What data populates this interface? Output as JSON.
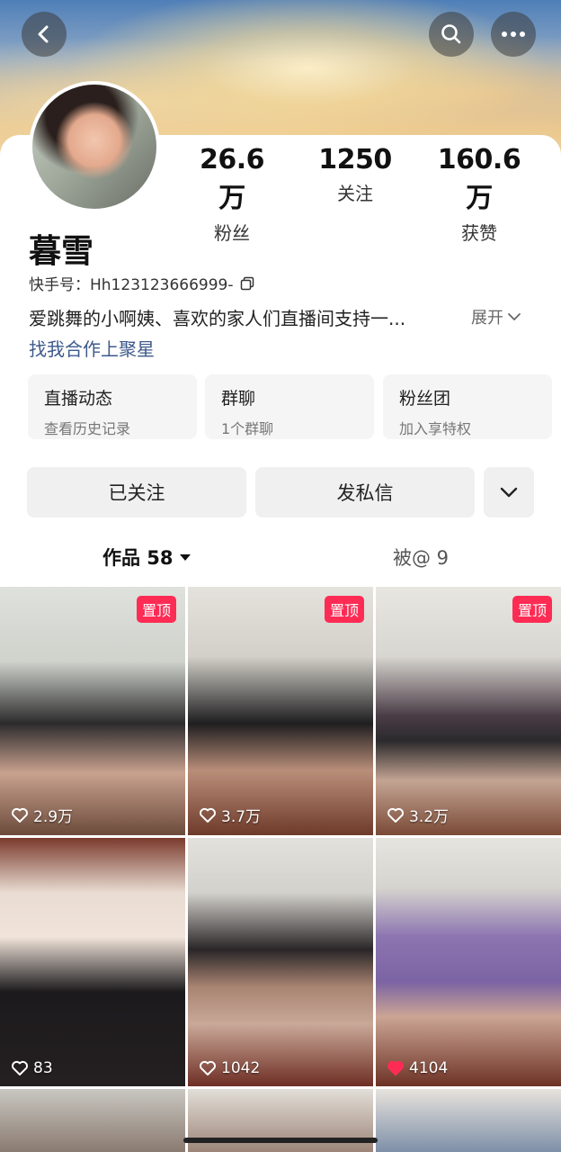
{
  "profile": {
    "stats": [
      {
        "num": "26.6万",
        "label": "粉丝"
      },
      {
        "num": "1250",
        "label": "关注"
      },
      {
        "num": "160.6万",
        "label": "获赞"
      }
    ],
    "name": "暮雪",
    "uid": "快手号：Hh123123666999-",
    "bio": "爱跳舞的小啊姨、喜欢的家人们直播间支持一...",
    "expand": "展开",
    "collab": "找我合作上聚星"
  },
  "quick_cards": [
    {
      "title": "直播动态",
      "sub": "查看历史记录"
    },
    {
      "title": "群聊",
      "sub": "1个群聊"
    },
    {
      "title": "粉丝团",
      "sub": "加入享特权"
    }
  ],
  "actions": {
    "follow": "已关注",
    "message": "发私信"
  },
  "tabs": {
    "works": "作品 58",
    "mentions": "被@ 9"
  },
  "videos": [
    {
      "likes": "2.9万",
      "pinned": "置顶",
      "liked": false
    },
    {
      "likes": "3.7万",
      "pinned": "置顶",
      "liked": false
    },
    {
      "likes": "3.2万",
      "pinned": "置顶",
      "liked": false
    },
    {
      "likes": "83",
      "pinned": "",
      "liked": false
    },
    {
      "likes": "1042",
      "pinned": "",
      "liked": false
    },
    {
      "likes": "4104",
      "pinned": "",
      "liked": true
    }
  ],
  "icons": [
    "back-icon",
    "search-icon",
    "more-icon",
    "copy-icon",
    "chevron-down-icon",
    "heart-icon",
    "caret-down-icon"
  ],
  "colors": {
    "accent": "#fe2c55",
    "link": "#3d5a8c"
  }
}
